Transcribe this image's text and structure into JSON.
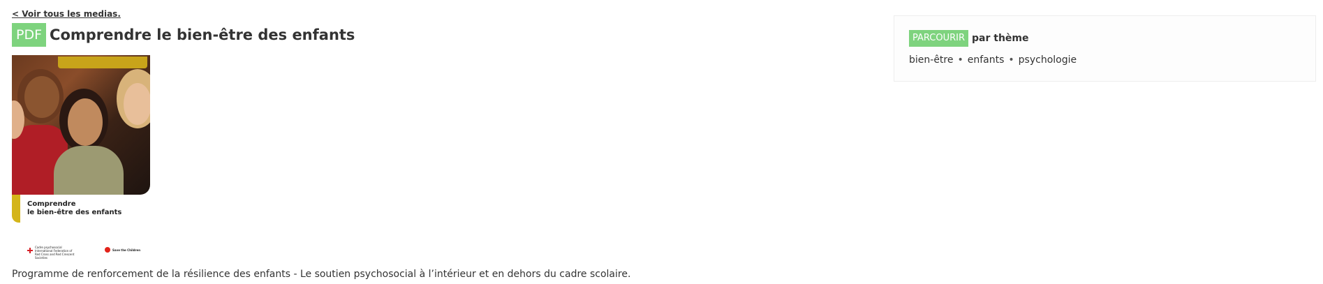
{
  "back_link": {
    "label": "< Voir tous les medias."
  },
  "media": {
    "type_badge": "PDF",
    "title": "Comprendre le bien-être des enfants",
    "cover": {
      "caption_line1": "Comprendre",
      "caption_line2": "le bien-être des enfants",
      "logo_left": "Cadre psychosocial International Federation of Red Cross and Red Crescent Societies",
      "logo_right": "Save the Children"
    },
    "description": "Programme de renforcement de la résilience des enfants - Le soutien psychosocial à l’intérieur et en dehors du cadre scolaire."
  },
  "browse": {
    "badge": "PARCOURIR",
    "suffix": "par thème",
    "separator": "•",
    "tags": [
      "bien-être",
      "enfants",
      "psychologie"
    ]
  },
  "colors": {
    "accent_green": "#7ed37e",
    "cover_yellow": "#d4b51a",
    "text": "#333333"
  }
}
